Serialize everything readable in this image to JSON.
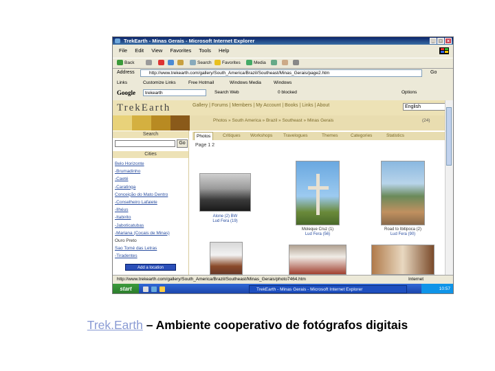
{
  "window": {
    "title": "TrekEarth - Minas Gerais - Microsoft Internet Explorer",
    "buttons": [
      "_",
      "□",
      "×"
    ]
  },
  "menu": [
    "File",
    "Edit",
    "View",
    "Favorites",
    "Tools",
    "Help"
  ],
  "toolbar": {
    "back": "Back",
    "search": "Search",
    "favorites": "Favorites",
    "media": "Media"
  },
  "address": {
    "label": "Address",
    "url": "http://www.trekearth.com/gallery/South_America/Brazil/Southeast/Minas_Gerais/page2.htm",
    "go": "Go"
  },
  "links": [
    "Links",
    "Customize Links",
    "Free Hotmail",
    "Windows Media",
    "Windows"
  ],
  "google": {
    "logo": "Google",
    "query": "trekearth",
    "search_web": "Search Web",
    "blocked": "0 blocked",
    "options": "Options"
  },
  "site": {
    "logo": "TrekEarth",
    "nav": "Gallery | Forums | Members | My Account | Books | Links | About",
    "language": "English",
    "breadcrumb": "Photos » South America » Brazil » Southeast » Minas Gerais",
    "count": "(24)",
    "tabs": [
      "Photos",
      "Critiques",
      "Workshops",
      "Travelogues",
      "Themes",
      "Categories",
      "Statistics"
    ],
    "page_label": "Page  1 2",
    "sidebar": {
      "search_head": "Search",
      "go": "Go",
      "cities_head": "Cities",
      "cities": [
        "Belo Horizonte",
        "-Brumadinho",
        "-Caeté",
        "-Caratinga",
        "Conceição do Mato Dentro",
        "-Conselheiro Lafaiete",
        "-Ilhéus",
        "-Itabirito",
        "-Jaboticatubas",
        "-Mariana (Cocais de Minas)",
        "Ouro Preto",
        "Sao Tomé das Letras",
        "-Tiradentes"
      ],
      "button": "Add a location"
    },
    "photos": [
      {
        "title": "Alone (2) BW",
        "author": "Lud Fera (19)"
      },
      {
        "title": "Moleque Cruz (1)",
        "author": "Lud Fera (56)"
      },
      {
        "title": "Road to Ibitipoca (2)",
        "author": "Lud Fera (90)"
      }
    ]
  },
  "status": {
    "url": "http://www.trekearth.com/gallery/South_America/Brazil/Southeast/Minas_Gerais/photo7464.htm",
    "zone": "Internet"
  },
  "taskbar": {
    "start": "start",
    "task": "TrekEarth - Minas Gerais - Microsoft Internet Explorer",
    "clock": "10:57"
  },
  "caption": {
    "link": "Trek.Earth",
    "rest": " – Ambiente cooperativo de fotógrafos digitais"
  },
  "colors": {
    "site_band": "#ede2b6",
    "link_blue": "#2a4ea0",
    "xp_taskbar": "#3168d5"
  }
}
